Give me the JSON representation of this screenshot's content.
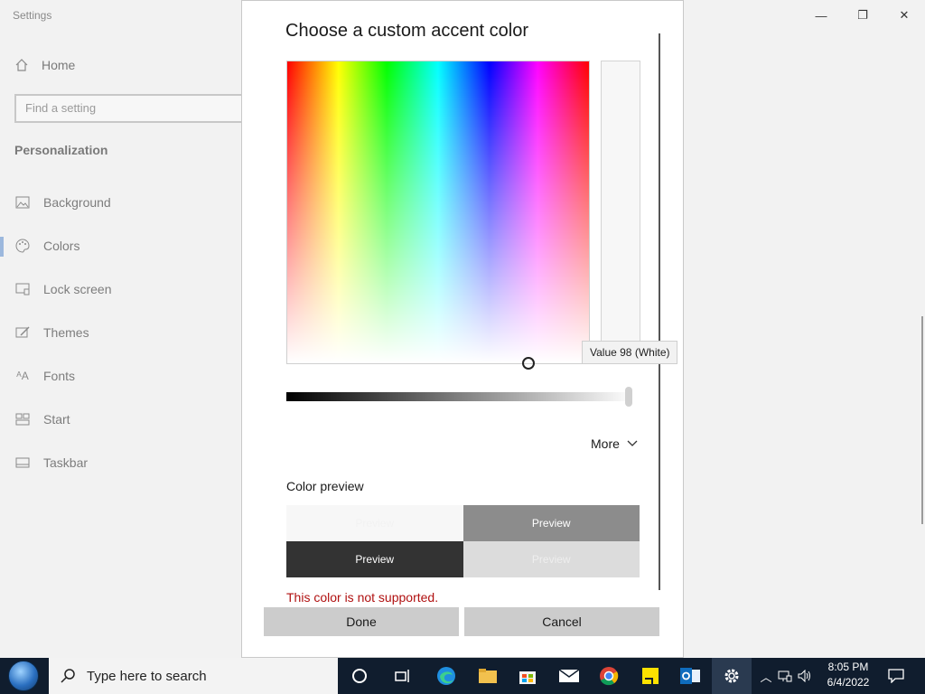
{
  "settings": {
    "window_title": "Settings",
    "home_label": "Home",
    "search_placeholder": "Find a setting",
    "section_title": "Personalization",
    "nav": [
      {
        "label": "Background",
        "icon": "image-icon"
      },
      {
        "label": "Colors",
        "icon": "palette-icon"
      },
      {
        "label": "Lock screen",
        "icon": "lock-screen-icon"
      },
      {
        "label": "Themes",
        "icon": "brush-icon"
      },
      {
        "label": "Fonts",
        "icon": "font-icon"
      },
      {
        "label": "Start",
        "icon": "start-icon"
      },
      {
        "label": "Taskbar",
        "icon": "taskbar-icon"
      }
    ],
    "window_controls": {
      "minimize": "—",
      "maximize": "❐",
      "close": "✕"
    }
  },
  "dialog": {
    "title": "Choose a custom accent color",
    "tooltip": "Value 98 (White)",
    "value_level_percent": 98,
    "more_label": "More",
    "preview_label": "Color preview",
    "preview_tiles": [
      "Preview",
      "Preview",
      "Preview",
      "Preview"
    ],
    "error": "This color is not supported.",
    "done_label": "Done",
    "cancel_label": "Cancel",
    "colors": {
      "error": "#b01010",
      "button": "#cccccc"
    }
  },
  "taskbar": {
    "search_placeholder": "Type here to search",
    "time": "8:05 PM",
    "date": "6/4/2022",
    "icons": [
      "cortana-icon",
      "task-view-icon",
      "edge-icon",
      "file-explorer-icon",
      "store-icon",
      "mail-icon",
      "chrome-icon",
      "sticky-notes-icon",
      "outlook-icon",
      "settings-icon"
    ],
    "background": "#101d2e"
  }
}
